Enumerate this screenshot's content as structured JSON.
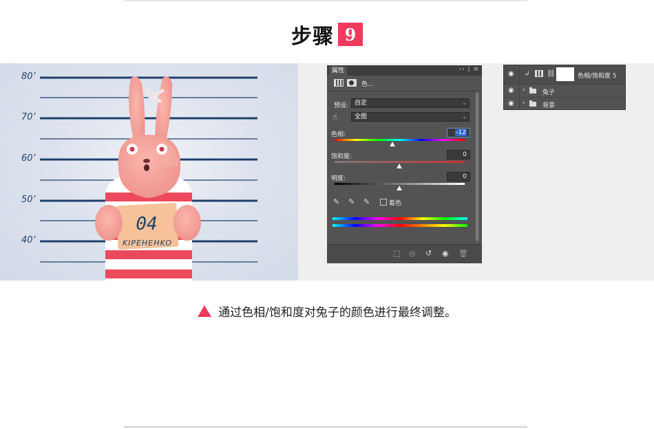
{
  "header": {
    "title": "步骤",
    "step_number": "9"
  },
  "mugshot": {
    "height_labels": [
      "80’",
      "70’",
      "60’",
      "50’",
      "40’"
    ],
    "sign_number": "04",
    "sign_name": "KIPEHEHKO"
  },
  "properties_panel": {
    "tab_label": "属性",
    "header_icons": "›› | ≡",
    "subtitle": "色...",
    "preset_label": "预设:",
    "preset_value": "自定",
    "channel_value": "全图",
    "hue_label": "色相:",
    "hue_value": "-12",
    "saturation_label": "饱和度:",
    "saturation_value": "0",
    "lightness_label": "明度:",
    "lightness_value": "0",
    "colorize_label": "着色",
    "colors": {
      "panel_bg": "#535353",
      "panel_header": "#3d3d3d"
    }
  },
  "layers_panel": {
    "layers": [
      {
        "name": "色相/饱和度 5",
        "visible": true,
        "type": "adjustment"
      },
      {
        "name": "兔子",
        "visible": true,
        "type": "group"
      },
      {
        "name": "背景",
        "visible": true,
        "type": "group"
      }
    ]
  },
  "caption": {
    "text": "通过色相/饱和度对兔子的颜色进行最终调整。"
  },
  "colors": {
    "accent": "#ee3a5d",
    "stripe_navy": "#1f3f6b",
    "rabbit_pink": "#f5a39c"
  }
}
